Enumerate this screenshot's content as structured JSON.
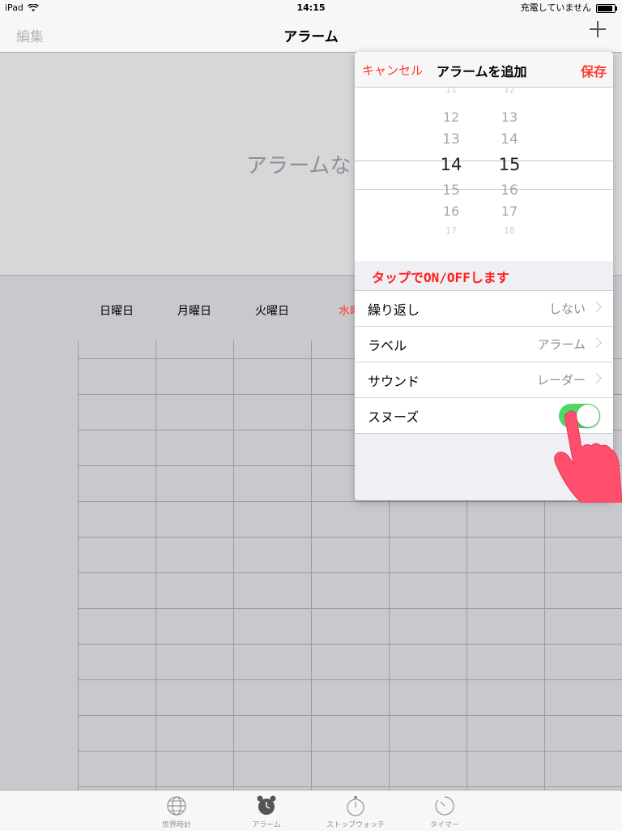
{
  "status": {
    "device": "iPad",
    "time": "14:15",
    "charging": "充電していません"
  },
  "navbar": {
    "edit": "編集",
    "title": "アラーム"
  },
  "empty_message": "アラームな",
  "days": [
    {
      "label": "日曜日",
      "red": false
    },
    {
      "label": "月曜日",
      "red": false
    },
    {
      "label": "火曜日",
      "red": false
    },
    {
      "label": "水曜",
      "red": true
    }
  ],
  "popover": {
    "cancel": "キャンセル",
    "title": "アラームを追加",
    "save": "保存",
    "hours": [
      "11",
      "12",
      "13",
      "14",
      "15",
      "16",
      "17"
    ],
    "minutes": [
      "12",
      "13",
      "14",
      "15",
      "16",
      "17",
      "18"
    ],
    "selected_hour": "14",
    "selected_minute": "15",
    "hint": "タップでON/OFFします",
    "rows": [
      {
        "label": "繰り返し",
        "value": "しない"
      },
      {
        "label": "ラベル",
        "value": "アラーム"
      },
      {
        "label": "サウンド",
        "value": "レーダー"
      }
    ],
    "snooze_label": "スヌーズ",
    "snooze_on": true
  },
  "tabs": [
    {
      "label": "世界時計",
      "icon": "globe-icon"
    },
    {
      "label": "アラーム",
      "icon": "alarm-clock-icon"
    },
    {
      "label": "ストップウォッチ",
      "icon": "stopwatch-icon"
    },
    {
      "label": "タイマー",
      "icon": "timer-icon"
    }
  ],
  "colors": {
    "accent": "#ff3b30",
    "toggle_on": "#4cd964",
    "hint": "#ff1d1d",
    "hand": "#ff4f6d"
  }
}
